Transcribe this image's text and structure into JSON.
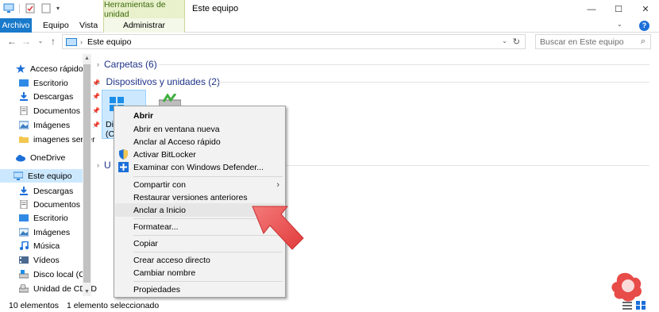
{
  "window": {
    "title": "Este equipo",
    "context_tab_header": "Herramientas de unidad",
    "controls": {
      "minimize": "—",
      "maximize": "☐",
      "close": "✕"
    },
    "help": "?"
  },
  "ribbon": {
    "tabs": [
      {
        "label": "Archivo"
      },
      {
        "label": "Equipo"
      },
      {
        "label": "Vista"
      },
      {
        "label": "Administrar"
      }
    ]
  },
  "address_bar": {
    "path": "Este equipo",
    "separator": "›",
    "search_placeholder": "Buscar en Este equipo"
  },
  "nav_pane": {
    "items": [
      {
        "label": "Acceso rápido",
        "icon": "star-icon"
      },
      {
        "label": "Escritorio",
        "icon": "desktop-folder-icon",
        "pinned": true
      },
      {
        "label": "Descargas",
        "icon": "downloads-icon",
        "pinned": true
      },
      {
        "label": "Documentos",
        "icon": "documents-icon",
        "pinned": true
      },
      {
        "label": "Imágenes",
        "icon": "pictures-icon",
        "pinned": true
      },
      {
        "label": "imagenes server",
        "icon": "folder-icon"
      },
      {
        "label": "OneDrive",
        "icon": "cloud-icon"
      },
      {
        "label": "Este equipo",
        "icon": "computer-icon",
        "selected": true
      },
      {
        "label": "Descargas",
        "icon": "downloads-icon"
      },
      {
        "label": "Documentos",
        "icon": "documents-icon"
      },
      {
        "label": "Escritorio",
        "icon": "desktop-folder-icon"
      },
      {
        "label": "Imágenes",
        "icon": "pictures-icon"
      },
      {
        "label": "Música",
        "icon": "music-icon"
      },
      {
        "label": "Vídeos",
        "icon": "videos-icon"
      },
      {
        "label": "Disco local (C:)",
        "icon": "drive-icon"
      },
      {
        "label": "Unidad de CD (D",
        "icon": "cd-drive-icon"
      }
    ]
  },
  "content": {
    "groups": [
      {
        "label": "Carpetas (6)",
        "state": "collapsed"
      },
      {
        "label": "Dispositivos y unidades (2)",
        "state": "expanded"
      },
      {
        "label": "U",
        "state": "collapsed"
      }
    ],
    "selected_tile_label_1": "Di",
    "selected_tile_label_2": "(C"
  },
  "context_menu": {
    "items": [
      {
        "label": "Abrir",
        "bold": true
      },
      {
        "label": "Abrir en ventana nueva"
      },
      {
        "label": "Anclar al Acceso rápido"
      },
      {
        "label": "Activar BitLocker",
        "icon": "shield-icon"
      },
      {
        "label": "Examinar con Windows Defender...",
        "icon": "defender-icon"
      },
      {
        "label": "Compartir con",
        "submenu": "›"
      },
      {
        "label": "Restaurar versiones anteriores"
      },
      {
        "label": "Anclar a Inicio",
        "highlighted": true
      },
      {
        "label": "Formatear..."
      },
      {
        "label": "Copiar"
      },
      {
        "label": "Crear acceso directo"
      },
      {
        "label": "Cambiar nombre"
      },
      {
        "label": "Propiedades"
      }
    ]
  },
  "status_bar": {
    "count": "10 elementos",
    "selection": "1 elemento seleccionado"
  },
  "colors": {
    "accent": "#1979ca",
    "selection": "#cce8ff",
    "context_tab": "#e8f0cc",
    "arrow": "#f05454"
  }
}
